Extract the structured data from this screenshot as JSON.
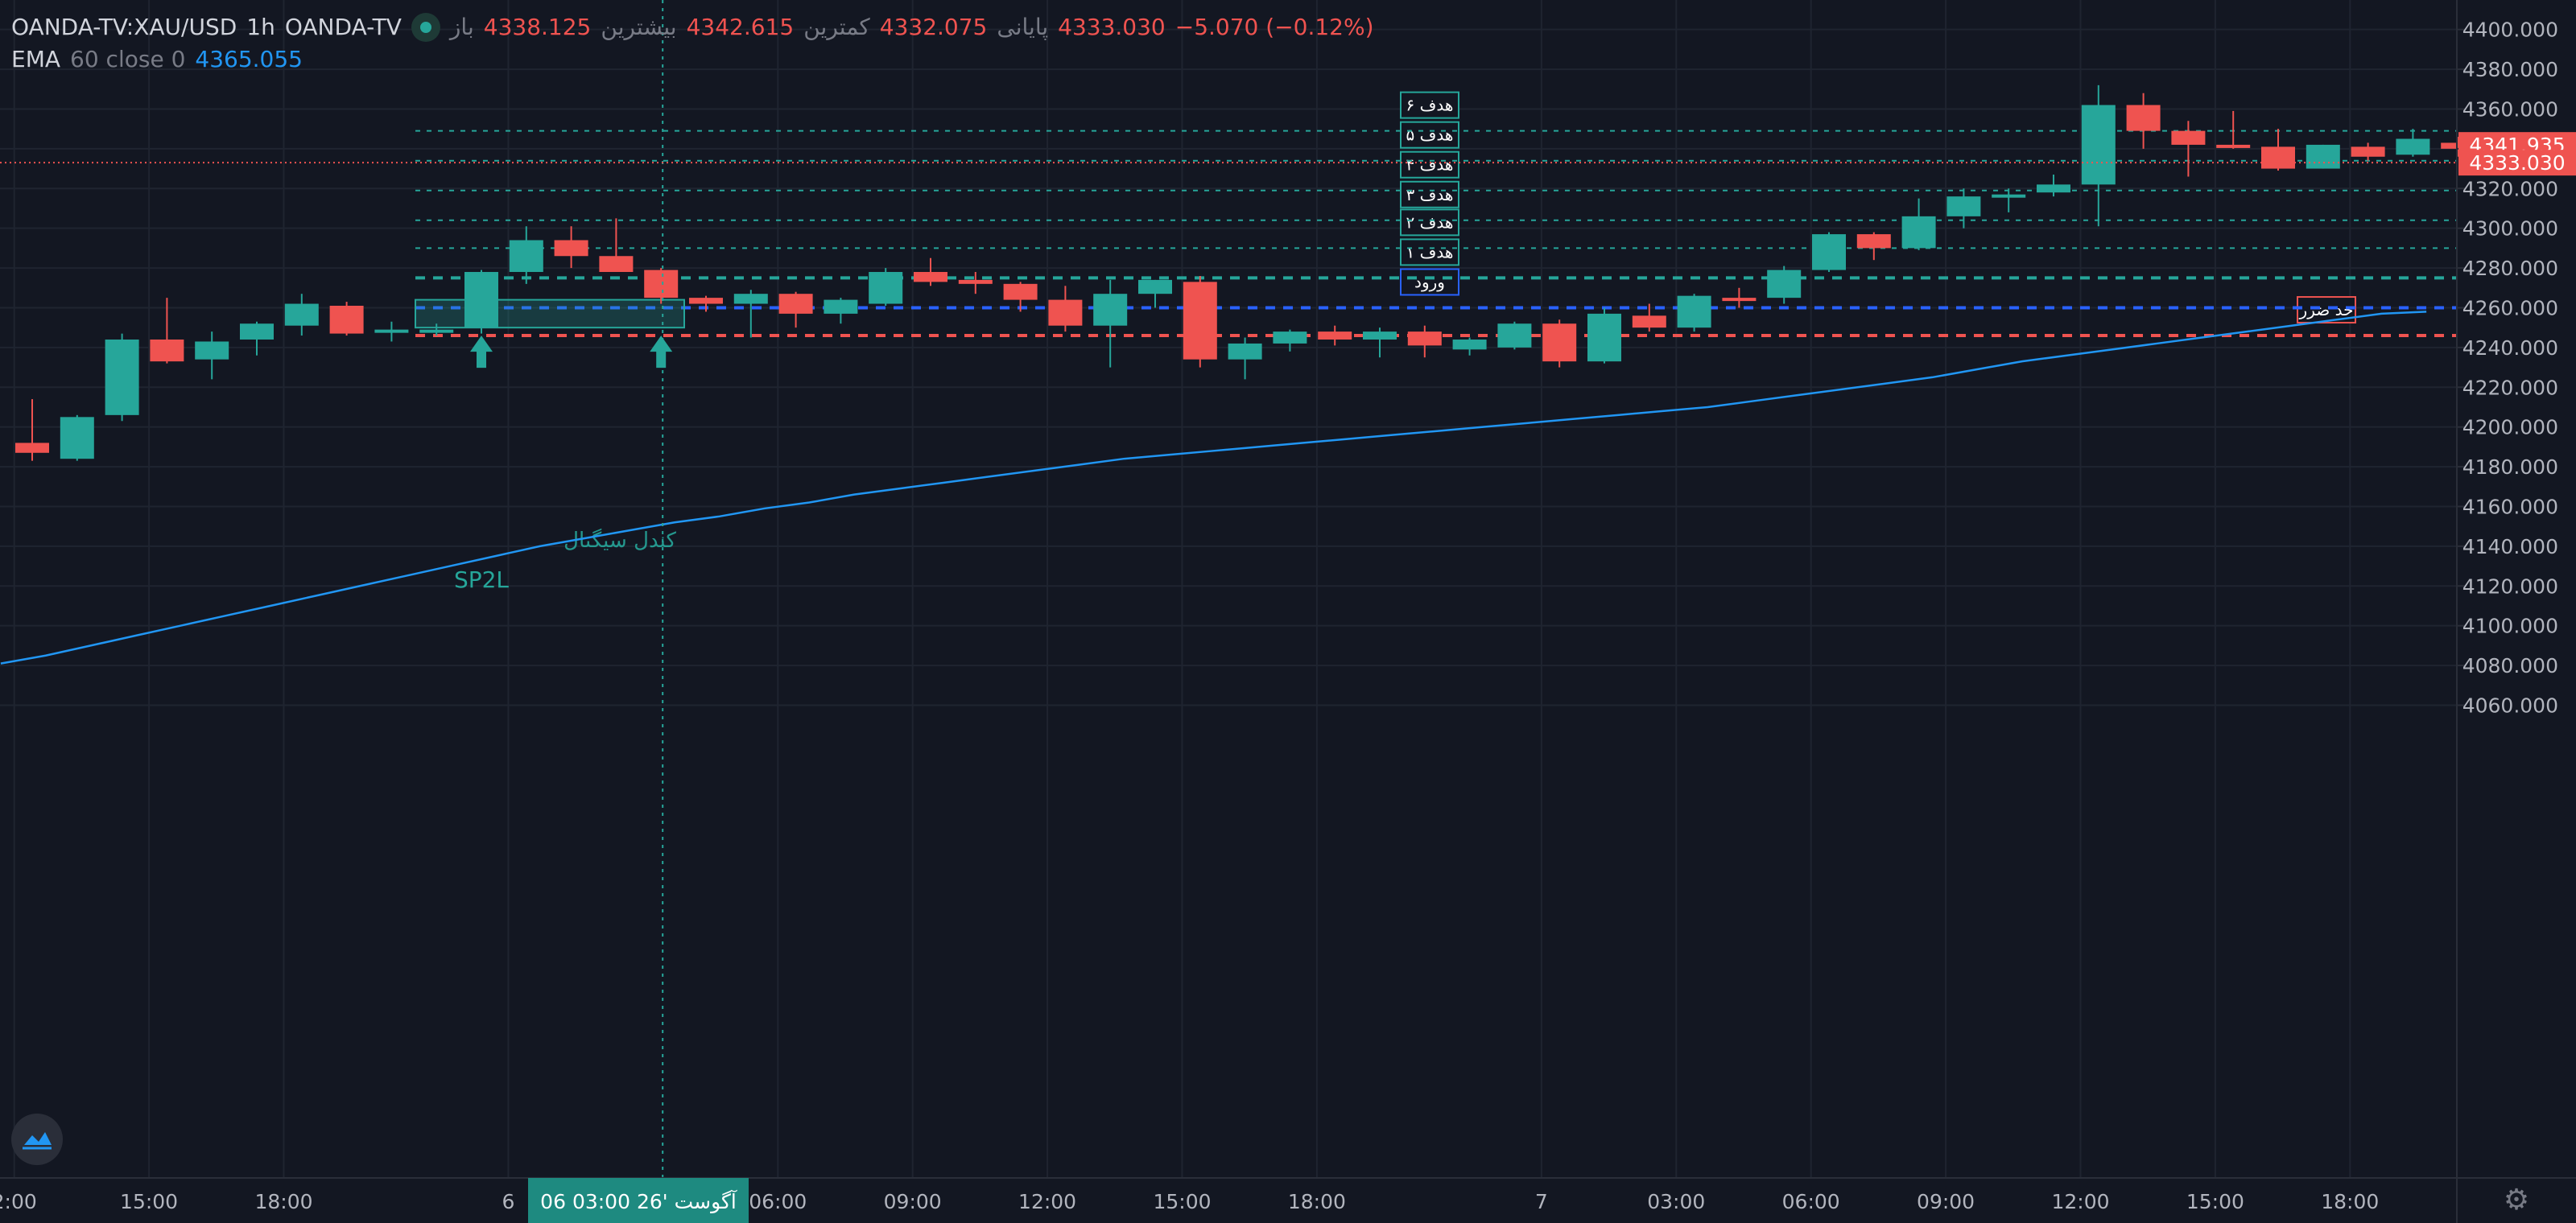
{
  "legend": {
    "symbol": "OANDA-TV:XAU/USD",
    "interval": "1h",
    "source": "OANDA-TV",
    "open_label": "باز",
    "open": "4338.125",
    "high_label": "بیشترین",
    "high": "4342.615",
    "low_label": "کمترین",
    "low": "4332.075",
    "close_label": "پایانی",
    "close": "4333.030",
    "change": "−5.070 (−0.12%)",
    "ema_name": "EMA",
    "ema_params": "60 close 0",
    "ema_value": "4365.055"
  },
  "colors": {
    "background": "#131722",
    "up": "#26a69a",
    "down": "#ef5350",
    "ema": "#2196f3",
    "entry": "#2962ff",
    "grid": "#1f2430"
  },
  "chart_data": {
    "type": "candlestick",
    "ylim": [
      4050,
      4410
    ],
    "y_ticks": [
      4060,
      4080,
      4100,
      4120,
      4140,
      4160,
      4180,
      4200,
      4220,
      4240,
      4260,
      4280,
      4300,
      4320,
      4340,
      4360,
      4380,
      4400
    ],
    "x_ticks": [
      {
        "label": "2:00",
        "bar": -0.4
      },
      {
        "label": "15:00",
        "bar": 2.6
      },
      {
        "label": "18:00",
        "bar": 5.6
      },
      {
        "label": "6",
        "bar": 10.6
      },
      {
        "label": "06:00",
        "bar": 16.6
      },
      {
        "label": "09:00",
        "bar": 19.6
      },
      {
        "label": "12:00",
        "bar": 22.6
      },
      {
        "label": "15:00",
        "bar": 25.6
      },
      {
        "label": "18:00",
        "bar": 28.6
      },
      {
        "label": "7",
        "bar": 33.6
      },
      {
        "label": "03:00",
        "bar": 36.6
      },
      {
        "label": "06:00",
        "bar": 39.6
      },
      {
        "label": "09:00",
        "bar": 42.6
      },
      {
        "label": "12:00",
        "bar": 45.6
      },
      {
        "label": "15:00",
        "bar": 48.6
      },
      {
        "label": "18:00",
        "bar": 51.6
      }
    ],
    "candles": [
      [
        4192,
        4214,
        4183,
        4187
      ],
      [
        4184,
        4206,
        4183,
        4205
      ],
      [
        4206,
        4247,
        4203,
        4244
      ],
      [
        4244,
        4265,
        4232,
        4233
      ],
      [
        4234,
        4248,
        4224,
        4243
      ],
      [
        4244,
        4253,
        4236,
        4252
      ],
      [
        4251,
        4267,
        4246,
        4262
      ],
      [
        4261,
        4263,
        4246,
        4247
      ],
      [
        4248,
        4253,
        4243,
        4249
      ],
      [
        4249,
        4252,
        4246,
        4249
      ],
      [
        4250,
        4279,
        4247,
        4278
      ],
      [
        4278,
        4301,
        4272,
        4294
      ],
      [
        4294,
        4301,
        4280,
        4286
      ],
      [
        4286,
        4305,
        4278,
        4278
      ],
      [
        4279,
        4280,
        4262,
        4265
      ],
      [
        4265,
        4266,
        4258,
        4262
      ],
      [
        4262,
        4269,
        4245,
        4267
      ],
      [
        4267,
        4268,
        4250,
        4257
      ],
      [
        4257,
        4265,
        4252,
        4264
      ],
      [
        4262,
        4280,
        4261,
        4278
      ],
      [
        4278,
        4285,
        4271,
        4273
      ],
      [
        4274,
        4278,
        4267,
        4272
      ],
      [
        4272,
        4273,
        4258,
        4264
      ],
      [
        4264,
        4271,
        4248,
        4251
      ],
      [
        4251,
        4274,
        4230,
        4267
      ],
      [
        4267,
        4274,
        4260,
        4274
      ],
      [
        4273,
        4276,
        4230,
        4234
      ],
      [
        4234,
        4245,
        4224,
        4242
      ],
      [
        4242,
        4249,
        4238,
        4248
      ],
      [
        4248,
        4251,
        4241,
        4244
      ],
      [
        4244,
        4250,
        4235,
        4248
      ],
      [
        4248,
        4251,
        4235,
        4241
      ],
      [
        4239,
        4245,
        4236,
        4244
      ],
      [
        4240,
        4253,
        4239,
        4252
      ],
      [
        4252,
        4254,
        4230,
        4233
      ],
      [
        4233,
        4260,
        4232,
        4257
      ],
      [
        4256,
        4262,
        4248,
        4250
      ],
      [
        4250,
        4267,
        4248,
        4266
      ],
      [
        4265,
        4270,
        4260,
        4264
      ],
      [
        4265,
        4281,
        4262,
        4279
      ],
      [
        4279,
        4298,
        4278,
        4297
      ],
      [
        4297,
        4298,
        4284,
        4290
      ],
      [
        4290,
        4315,
        4289,
        4306
      ],
      [
        4306,
        4320,
        4300,
        4316
      ],
      [
        4316,
        4320,
        4308,
        4317
      ],
      [
        4318,
        4327,
        4316,
        4322
      ],
      [
        4322,
        4372,
        4301,
        4362
      ],
      [
        4362,
        4368,
        4340,
        4349
      ],
      [
        4349,
        4354,
        4326,
        4342
      ],
      [
        4342,
        4359,
        4340,
        4341
      ],
      [
        4341,
        4350,
        4329,
        4330
      ],
      [
        4330,
        4342,
        4330,
        4342
      ],
      [
        4341,
        4343,
        4334,
        4336
      ],
      [
        4337,
        4350,
        4336,
        4345
      ],
      [
        4343,
        4346,
        4336,
        4340
      ]
    ],
    "ema_series": [
      4081,
      4085,
      4090,
      4095,
      4100,
      4105,
      4110,
      4115,
      4120,
      4125,
      4130,
      4135,
      4140,
      4144,
      4148,
      4152,
      4155,
      4159,
      4162,
      4166,
      4169,
      4172,
      4175,
      4178,
      4181,
      4184,
      4186,
      4188,
      4190,
      4192,
      4194,
      4196,
      4198,
      4200,
      4202,
      4204,
      4206,
      4208,
      4210,
      4213,
      4216,
      4219,
      4222,
      4225,
      4229,
      4233,
      4236,
      4239,
      4242,
      4245,
      4248,
      4251,
      4254,
      4257,
      4258
    ],
    "levels": [
      {
        "label": "حد ضرر",
        "value": 4246,
        "color": "#ef5350",
        "style": "dash"
      },
      {
        "label": "ورود",
        "value": 4260,
        "color": "#2962ff",
        "style": "dash"
      },
      {
        "label": "هدف ۱",
        "value": 4275,
        "color": "#26a69a",
        "style": "dash"
      },
      {
        "label": "هدف ۲",
        "value": 4290,
        "color": "#26a69a",
        "style": "dot"
      },
      {
        "label": "هدف ۳",
        "value": 4304,
        "color": "#26a69a",
        "style": "dot"
      },
      {
        "label": "هدف ۴",
        "value": 4319,
        "color": "#26a69a",
        "style": "dot"
      },
      {
        "label": "هدف ۵",
        "value": 4334,
        "color": "#26a69a",
        "style": "dot"
      },
      {
        "label": "هدف ۶",
        "value": 4349,
        "color": "#26a69a",
        "style": "dot"
      }
    ],
    "price_tags": [
      {
        "value": "4341.935",
        "y": 4341.9
      },
      {
        "value": "4333.030",
        "y": 4333.0
      }
    ],
    "annotations": {
      "signal_label": "SP2L",
      "signal_bar": 10,
      "box_label": "کندل سیگنال",
      "box_top": 4264,
      "box_bottom": 4250,
      "cursor_bar": 14,
      "cursor_label": "06 آگوست '26   03:00"
    }
  }
}
